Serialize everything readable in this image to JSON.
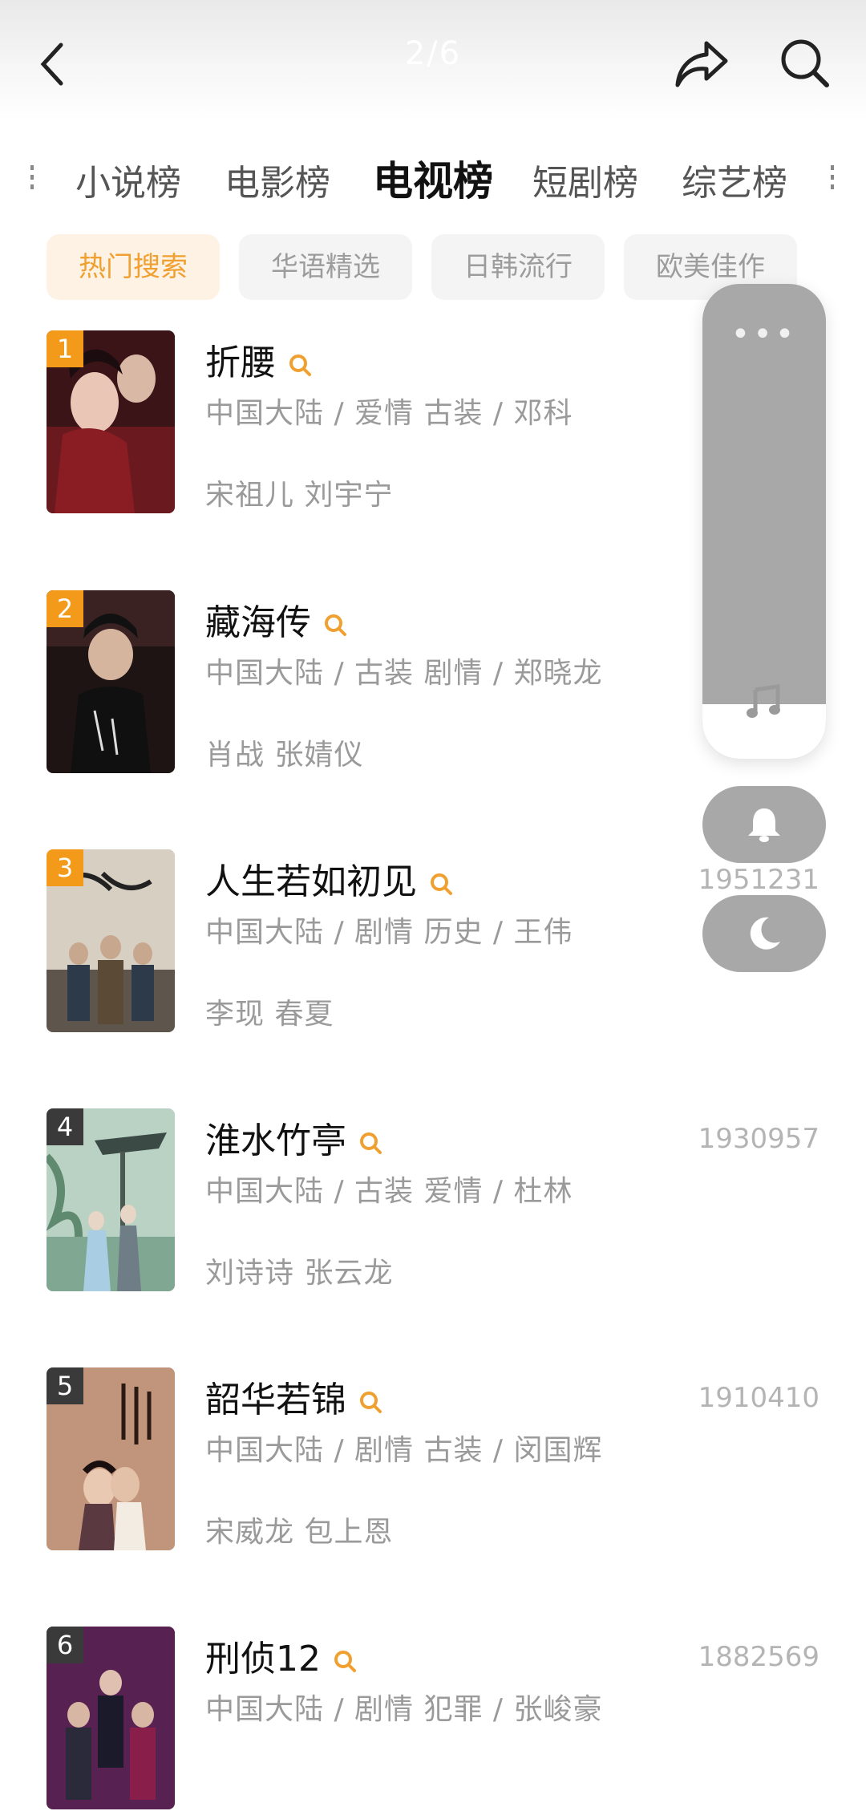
{
  "header": {
    "pager": "2/6"
  },
  "tabs": [
    "小说榜",
    "电影榜",
    "电视榜",
    "短剧榜",
    "综艺榜"
  ],
  "active_tab": "电视榜",
  "chips": [
    "热门搜索",
    "华语精选",
    "日韩流行",
    "欧美佳作"
  ],
  "active_chip": "热门搜索",
  "colors": {
    "accent": "#f0a030",
    "rank_top": "#f39a1a",
    "rank_other": "#3a3a3a"
  },
  "items": [
    {
      "rank": "1",
      "title": "折腰",
      "meta": "中国大陆 / 爱情 古装 / 邓科",
      "cast": "宋祖儿 刘宇宁",
      "score": ""
    },
    {
      "rank": "2",
      "title": "藏海传",
      "meta": "中国大陆 / 古装 剧情 / 郑晓龙",
      "cast": "肖战 张婧仪",
      "score": ""
    },
    {
      "rank": "3",
      "title": "人生若如初见",
      "meta": "中国大陆 / 剧情 历史 / 王伟",
      "cast": "李现 春夏",
      "score": "1951231"
    },
    {
      "rank": "4",
      "title": "淮水竹亭",
      "meta": "中国大陆 / 古装 爱情 / 杜林",
      "cast": "刘诗诗 张云龙",
      "score": "1930957"
    },
    {
      "rank": "5",
      "title": "韶华若锦",
      "meta": "中国大陆 / 剧情 古装 / 闵国辉",
      "cast": "宋威龙 包上恩",
      "score": "1910410"
    },
    {
      "rank": "6",
      "title": "刑侦12",
      "meta": "中国大陆 / 剧情 犯罪 / 张峻豪",
      "cast": "",
      "score": "1882569"
    }
  ],
  "float_panel": {
    "menu": "•••",
    "icons": [
      "music-icon",
      "bell-icon",
      "moon-icon"
    ]
  }
}
